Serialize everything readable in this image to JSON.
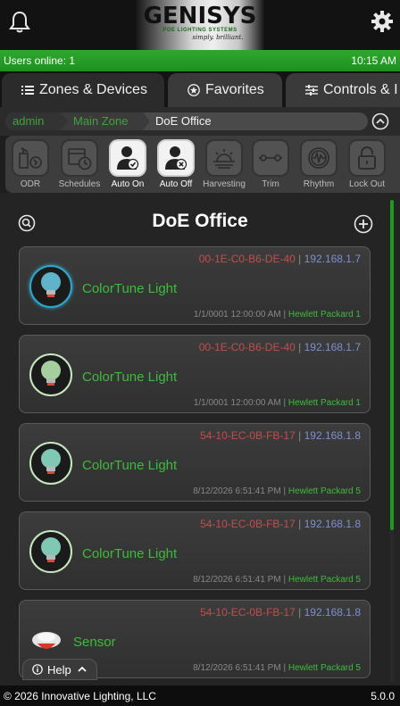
{
  "header": {
    "logo_text": "GENISYS",
    "logo_sub": "POE LIGHTING SYSTEMS",
    "logo_tagline": "simply. brilliant.",
    "bell_icon": "bell-icon",
    "settings_icon": "gear-icon"
  },
  "status": {
    "users_online": "Users online: 1",
    "time": "10:15 AM"
  },
  "tabs": [
    {
      "label": "Zones & Devices",
      "icon": "list-icon"
    },
    {
      "label": "Favorites",
      "icon": "star-icon"
    },
    {
      "label": "Controls & I",
      "icon": "sliders-icon"
    }
  ],
  "breadcrumb": {
    "items": [
      "admin",
      "Main Zone",
      "DoE Office"
    ],
    "up_icon": "chevron-up-icon"
  },
  "toolbar": {
    "items": [
      {
        "label": "ODR",
        "icon": "odr-icon",
        "active": false
      },
      {
        "label": "Schedules",
        "icon": "calendar-clock-icon",
        "active": false
      },
      {
        "label": "Auto On",
        "icon": "person-check-icon",
        "active": true
      },
      {
        "label": "Auto Off",
        "icon": "person-x-icon",
        "active": true
      },
      {
        "label": "Harvesting",
        "icon": "sun-icon",
        "active": false
      },
      {
        "label": "Trim",
        "icon": "trim-icon",
        "active": false
      },
      {
        "label": "Rhythm",
        "icon": "rhythm-icon",
        "active": false
      },
      {
        "label": "Lock Out",
        "icon": "lock-icon",
        "active": false
      }
    ]
  },
  "zone": {
    "title": "DoE Office",
    "zoom_icon": "zoom-icon",
    "add_icon": "plus-circle-icon"
  },
  "devices": [
    {
      "mac": "00-1E-C0-B6-DE-40",
      "ip": "192.168.1.7",
      "name": "ColorTune Light",
      "date": "1/1/0001 12:00:00 AM",
      "switch": "Hewlett Packard 1",
      "icon": "bulb-icon",
      "selected": true
    },
    {
      "mac": "00-1E-C0-B6-DE-40",
      "ip": "192.168.1.7",
      "name": "ColorTune Light",
      "date": "1/1/0001 12:00:00 AM",
      "switch": "Hewlett Packard 1",
      "icon": "bulb-icon",
      "selected": false
    },
    {
      "mac": "54-10-EC-0B-FB-17",
      "ip": "192.168.1.8",
      "name": "ColorTune Light",
      "date": "8/12/2026 6:51:41 PM",
      "switch": "Hewlett Packard 5",
      "icon": "bulb-icon",
      "selected": false
    },
    {
      "mac": "54-10-EC-0B-FB-17",
      "ip": "192.168.1.8",
      "name": "ColorTune Light",
      "date": "8/12/2026 6:51:41 PM",
      "switch": "Hewlett Packard 5",
      "icon": "bulb-icon",
      "selected": false
    },
    {
      "mac": "54-10-EC-0B-FB-17",
      "ip": "192.168.1.8",
      "name": "Sensor",
      "date": "8/12/2026 6:51:41 PM",
      "switch": "Hewlett Packard 5",
      "icon": "sensor-icon",
      "selected": false
    }
  ],
  "help": {
    "label": "Help",
    "info_icon": "info-icon",
    "chevron_icon": "chevron-up-icon"
  },
  "footer": {
    "copyright": "© 2026 Innovative Lighting, LLC",
    "version": "5.0.0"
  },
  "colors": {
    "accent_green": "#1e8f1e",
    "mac_red": "#c24e4e",
    "ip_blue": "#7f8fcf",
    "name_green": "#3dbb3d",
    "selected_cyan": "#2fa6c9"
  }
}
